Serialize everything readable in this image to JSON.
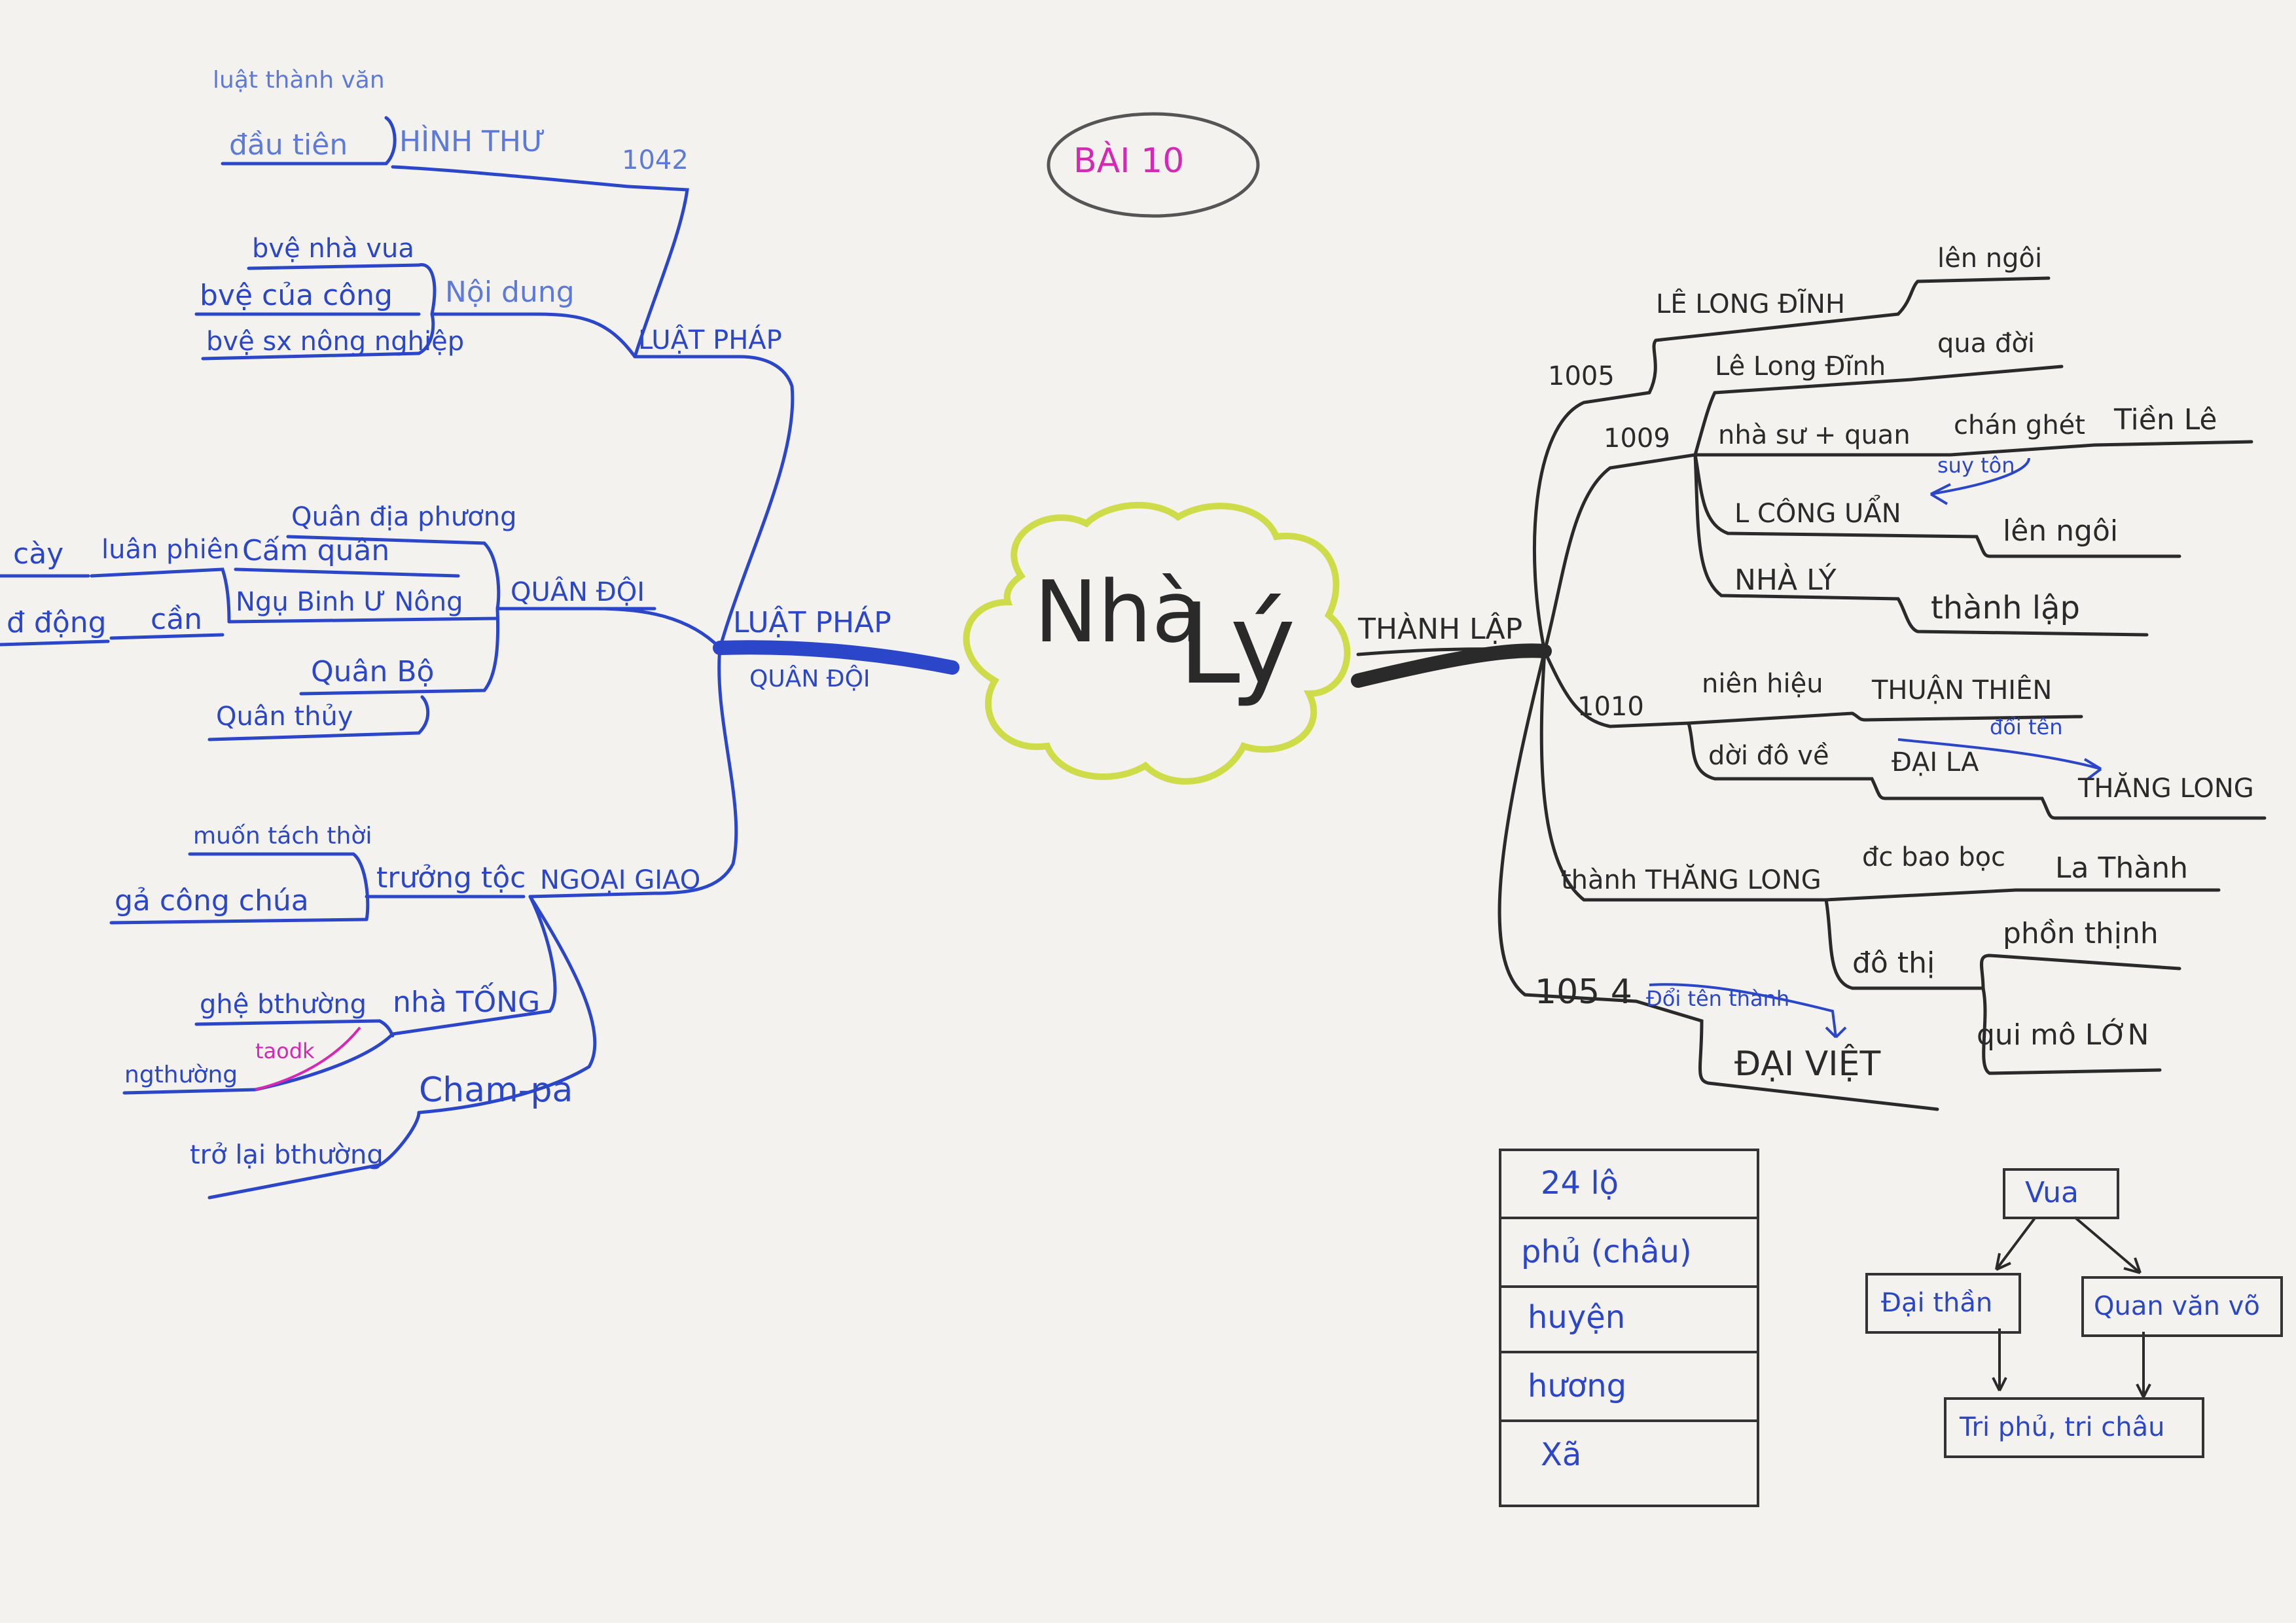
{
  "title_oval": "BÀI 10",
  "center": {
    "word1": "Nhà",
    "word2": "Lý"
  },
  "left": {
    "main_branch": {
      "line1": "LUẬT PHÁP",
      "line2": "QUÂN ĐỘI"
    },
    "luat_phap": {
      "label": "LUẬT PHÁP",
      "hinh_thu": "HÌNH THƯ",
      "year": "1042",
      "luat_thanh_van": "luật thành văn",
      "dau_tien": "đầu tiên",
      "noi_dung": "Nội dung",
      "items": [
        "bvệ nhà vua",
        "bvệ của công",
        "bvệ sx nông nghiệp"
      ]
    },
    "quan_doi": {
      "label": "QUÂN ĐỘI",
      "quan_dia_phuong": "Quân địa phương",
      "cam_quan": "Cấm quân",
      "ngu_binh": "Ngụ Binh Ư Nông",
      "luan_phien": "luân phiên",
      "cay": "cày",
      "can": "cần",
      "d_dong": "đ động",
      "quan_bo": "Quân Bộ",
      "quan_thuy": "Quân thủy"
    },
    "ngoai_giao": {
      "label": "NGOẠI GIAO",
      "truong_toc": "trưởng tộc",
      "muon_tach_thoi": "muốn tách thời",
      "ga_cong_chua": "gả công chúa",
      "nha_tong": "nhà TỐNG",
      "giu_bthuong": "ghệ bthường",
      "ngthuong": "ngthường",
      "taodk": "taodk",
      "cham_pa": "Cham-pa",
      "tro_lai": "trở lại bthường"
    }
  },
  "right": {
    "main_branch": "THÀNH LẬP",
    "y1005": "1005",
    "le_long_dinh_caps": "LÊ LONG ĐĨNH",
    "len_ngoi_1": "lên ngôi",
    "y1009": "1009",
    "le_long_dinh": "Lê Long Đĩnh",
    "qua_doi": "qua đời",
    "nha_su_quan": "nhà sư + quan",
    "chan_ghet": "chán ghét",
    "tien_le": "Tiền Lê",
    "suy_ton": "suy tôn",
    "ly_cong_uan": "L  CÔNG UẨN",
    "len_ngoi_2": "lên ngôi",
    "nha_ly": "NHÀ LÝ",
    "thanh_lap": "thành lập",
    "y1010": "1010",
    "nien_hieu": "niên hiệu",
    "thuan_thien": "THUẬN THIÊN",
    "doi_do_ve": "dời đô về",
    "dai_la": "ĐẠI LA",
    "doi_ten": "đổi tên",
    "thang_long": "THĂNG LONG",
    "thanh_thang_long": "thành THĂNG LONG",
    "dc_bao_boc": "đc bao bọc",
    "la_thanh": "La Thành",
    "do_thi": "đô thị",
    "phon_thinh": "phồn thịnh",
    "qui_mo": "qui mô LỚN",
    "y1054": "105 4",
    "doi_ten_thanh": "Đổi tên thành",
    "dai_viet": "ĐẠI VIỆT"
  },
  "admin_table": {
    "rows": [
      "24 lộ",
      "phủ (châu)",
      "huyện",
      "hương",
      "Xã"
    ]
  },
  "hierarchy": {
    "vua": "Vua",
    "dai_than": "Đại thần",
    "quan_van_vo": "Quan văn võ",
    "tri_phu": "Tri phủ, tri châu"
  },
  "colors": {
    "blue_ink": "#2b46c8",
    "black_ink": "#2a2a2a",
    "pink_ink": "#d428b5",
    "cloud": "#cfdc4a",
    "paper": "#f3f2ee"
  }
}
